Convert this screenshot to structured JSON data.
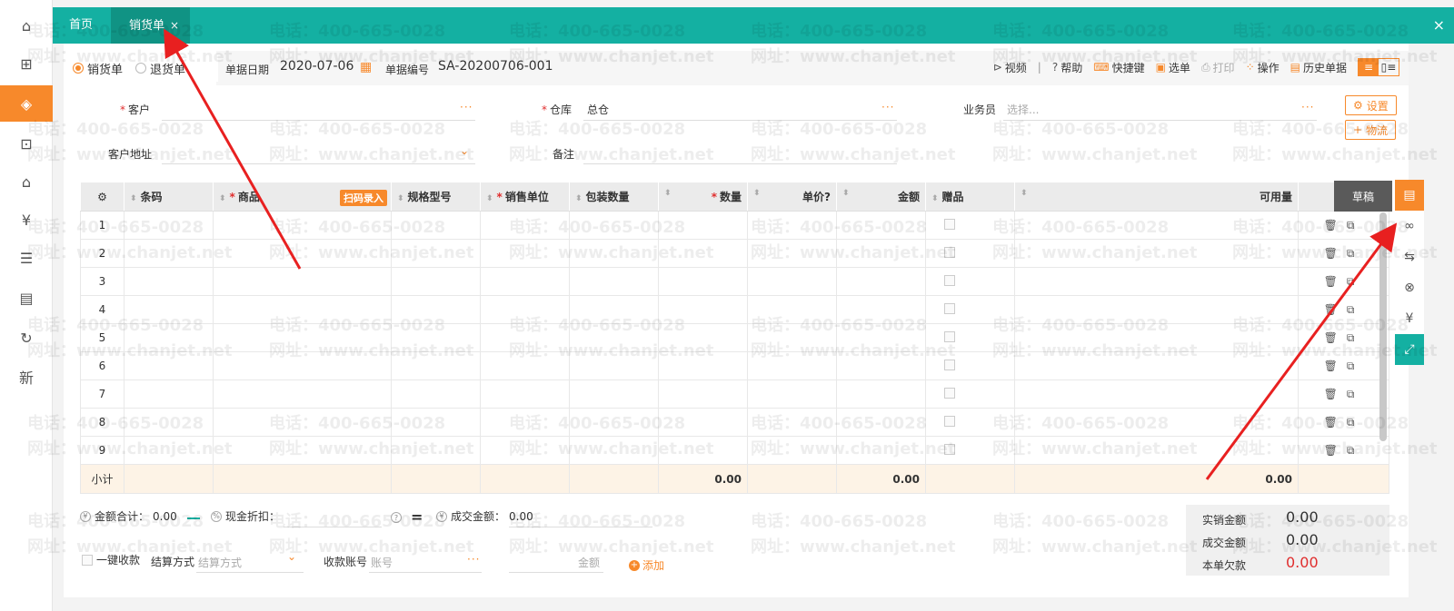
{
  "tabs": {
    "home": "首页",
    "active": "销货单",
    "close_symbol": "×"
  },
  "sidebar": {
    "icons": [
      "home-icon",
      "gift-icon",
      "sales-icon",
      "bag-icon",
      "warehouse-icon",
      "finance-icon",
      "report-icon",
      "card-icon",
      "refresh-icon",
      "new-icon"
    ]
  },
  "doc_type": {
    "sale": "销货单",
    "return": "退货单"
  },
  "header": {
    "date_label": "单据日期",
    "date_value": "2020-07-06",
    "number_label": "单据编号",
    "number_value": "SA-20200706-001"
  },
  "toolbar": {
    "video": "视频",
    "sep": "|",
    "help": "帮助",
    "shortcut": "快捷键",
    "select": "选单",
    "print": "打印",
    "operate": "操作",
    "history": "历史单据"
  },
  "form": {
    "customer_label": "客户",
    "warehouse_label": "仓库",
    "warehouse_value": "总仓",
    "salesperson_label": "业务员",
    "salesperson_placeholder": "选择...",
    "address_label": "客户地址",
    "remark_label": "备注",
    "settings_btn": "设置",
    "logistics_btn": "物流",
    "more": "···",
    "req": "*"
  },
  "grid": {
    "headers": {
      "barcode": "条码",
      "product": "商品",
      "scan": "扫码录入",
      "spec": "规格型号",
      "unit": "销售单位",
      "pack": "包装数量",
      "qty": "数量",
      "price": "单价",
      "amount": "金额",
      "gift": "赠品",
      "avail": "可用量"
    },
    "rows": [
      "1",
      "2",
      "3",
      "4",
      "5",
      "6",
      "7",
      "8",
      "9"
    ],
    "subtotal_label": "小计",
    "subtotal_qty": "0.00",
    "subtotal_amount": "0.00",
    "subtotal_avail": "0.00",
    "draft": "草稿"
  },
  "footer": {
    "total_label": "金额合计：",
    "total_value": "0.00",
    "discount_label": "现金折扣：",
    "deal_label": "成交金额：",
    "deal_value": "0.00",
    "one_click": "一键收款",
    "settle_label": "结算方式",
    "settle_placeholder": "结算方式",
    "account_label": "收款账号",
    "account_placeholder": "账号",
    "amount_placeholder": "金额",
    "add": "添加"
  },
  "summary": {
    "actual_label": "实销金额",
    "actual_value": "0.00",
    "deal_label": "成交金额",
    "deal_value": "0.00",
    "owed_label": "本单欠款",
    "owed_value": "0.00"
  },
  "watermark": {
    "phone": "电话：400-665-0028",
    "site": "网址：www.chanjet.net"
  },
  "colors": {
    "teal": "#14b0a2",
    "orange": "#f7892b",
    "red": "#e02e2e"
  }
}
